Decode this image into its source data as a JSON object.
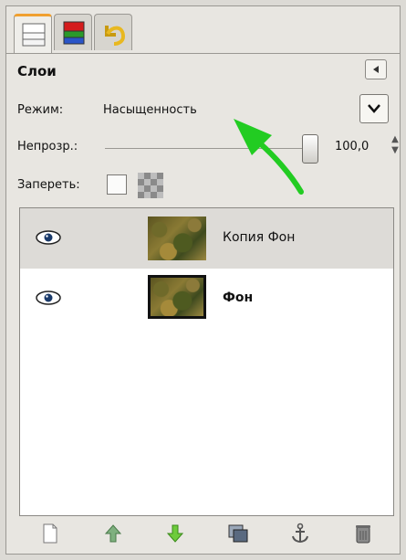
{
  "tabs": [
    {
      "icon": "layers-icon"
    },
    {
      "icon": "channels-icon"
    },
    {
      "icon": "undo-history-icon"
    }
  ],
  "panel": {
    "title": "Слои",
    "menu_icon": "panel-menu-triangle-icon"
  },
  "mode": {
    "label": "Режим:",
    "value": "Насыщенность"
  },
  "opacity": {
    "label": "Непрозр.:",
    "value": "100,0",
    "level": 1.0
  },
  "lock": {
    "label": "Запереть:"
  },
  "layers": [
    {
      "name": "Копия Фон",
      "visible": true,
      "selected": true,
      "bold": false
    },
    {
      "name": "Фон",
      "visible": true,
      "selected": false,
      "bold": true
    }
  ],
  "toolbar": {
    "icons": [
      "new-layer-icon",
      "raise-layer-icon",
      "lower-layer-icon",
      "duplicate-layer-icon",
      "anchor-layer-icon",
      "delete-layer-icon"
    ]
  },
  "annotation": {
    "arrow_color": "#22cc22"
  }
}
